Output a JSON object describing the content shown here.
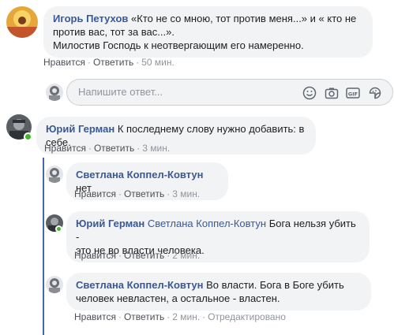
{
  "comments": [
    {
      "author": "Игорь Петухов",
      "text": "«Кто не со мною, тот против меня...» и « кто не против вас, тот за вас...».",
      "text2": "Милостив Господь к неотвергающим его намеренно.",
      "like": "Нравится",
      "reply": "Ответить",
      "time": "50 мин."
    },
    {
      "author": "Юрий Герман",
      "text": "К последнему слову нужно добавить: в себе.",
      "like": "Нравится",
      "reply": "Ответить",
      "time": "3 мин."
    }
  ],
  "reply_box": {
    "placeholder": "Напишите ответ..."
  },
  "replies": [
    {
      "author": "Светлана Коппел-Ковтун",
      "text": "нет",
      "like": "Нравится",
      "reply": "Ответить",
      "time": "3 мин."
    },
    {
      "author": "Юрий Герман",
      "mention": "Светлана Коппел-Ковтун",
      "text": "Бога нельзя убить -",
      "text2": "это не во власти человека.",
      "like": "Нравится",
      "reply": "Ответить",
      "time": "2 мин."
    },
    {
      "author": "Светлана Коппел-Ковтун",
      "text": "Во власти. Бога в Боге убить",
      "text2": "человек невластен, а остальное - властен.",
      "like": "Нравится",
      "reply": "Ответить",
      "time": "2 мин.",
      "edited": "Отредактировано"
    }
  ],
  "colors": {
    "link": "#385898",
    "bubble": "#f2f3f5",
    "online": "#42b72a",
    "thread": "#4267b2"
  },
  "icons": [
    "emoji-icon",
    "camera-icon",
    "gif-icon",
    "sticker-icon"
  ]
}
